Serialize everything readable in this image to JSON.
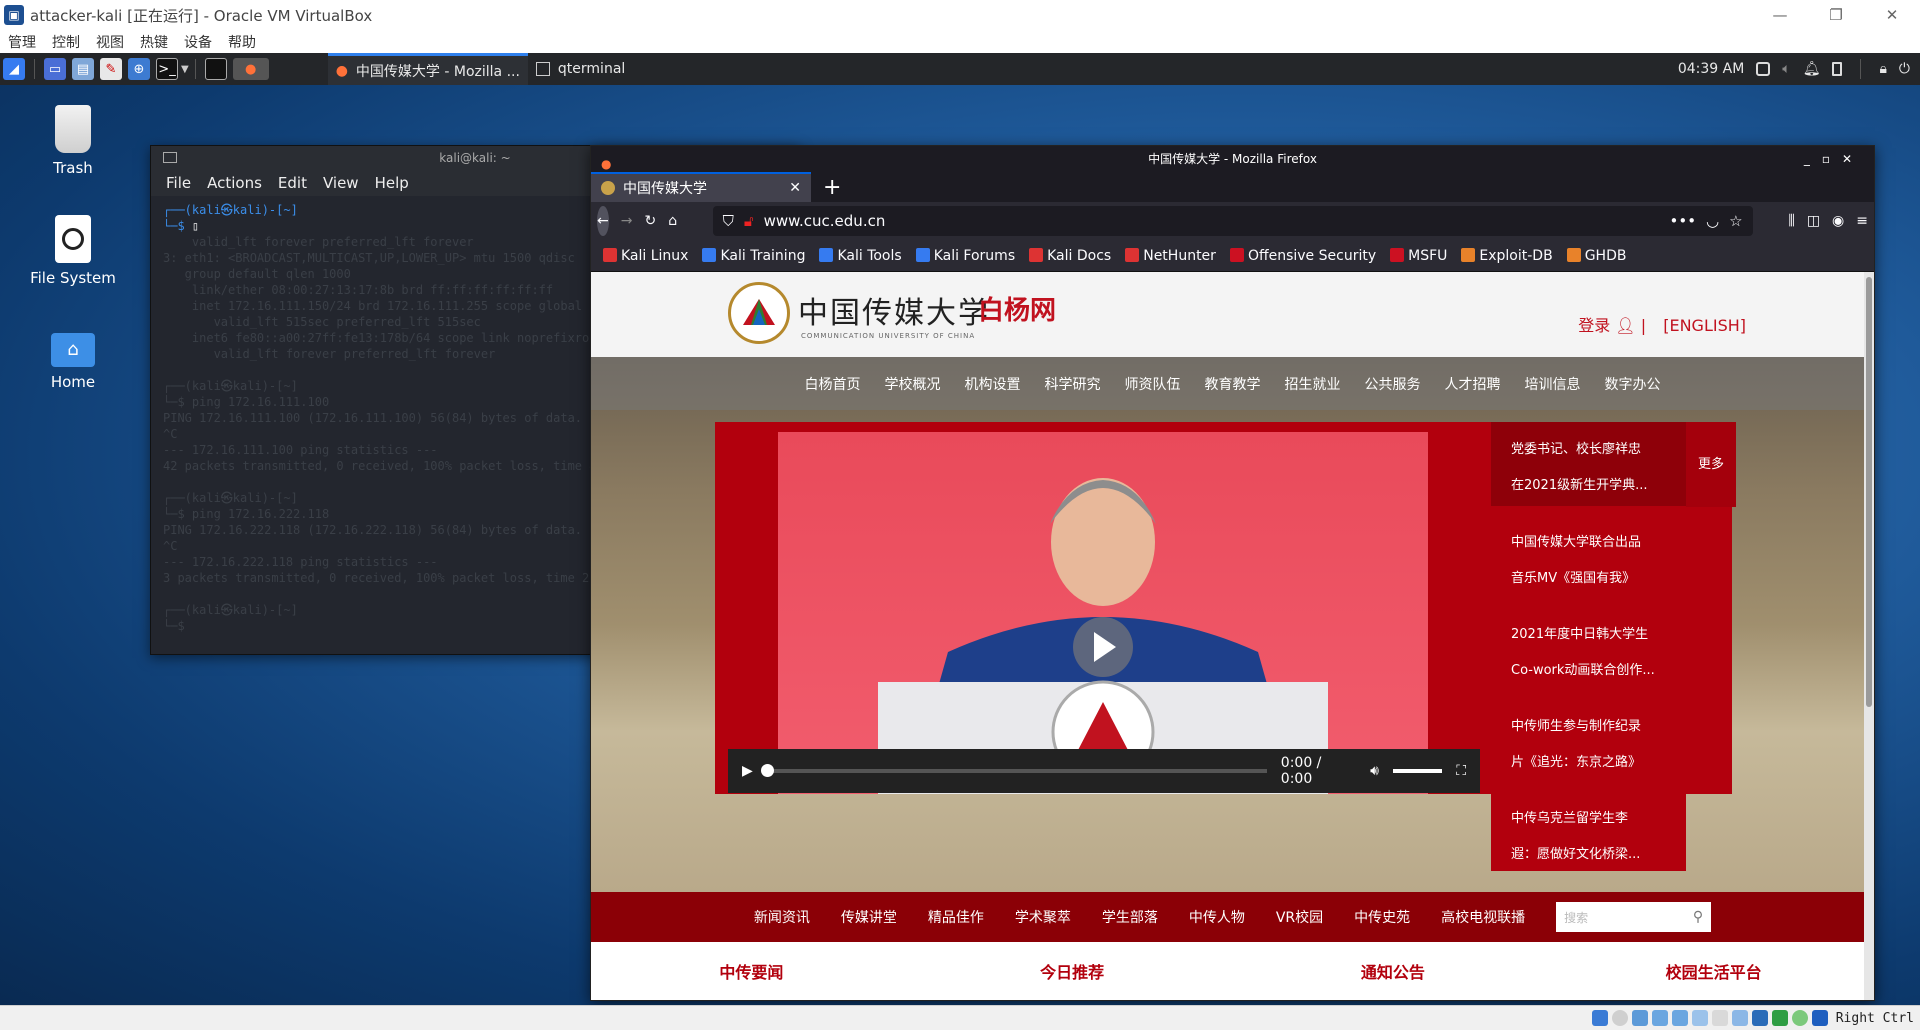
{
  "vbox": {
    "title": "attacker-kali [正在运行] - Oracle VM VirtualBox",
    "menu": [
      "管理",
      "控制",
      "视图",
      "热键",
      "设备",
      "帮助"
    ],
    "host_key": "Right Ctrl"
  },
  "panel": {
    "tasks": [
      {
        "label": "中国传媒大学 - Mozilla ..."
      },
      {
        "label": "qterminal"
      }
    ],
    "time": "04:39 AM"
  },
  "desktop": {
    "icons": [
      {
        "label": "Trash"
      },
      {
        "label": "File System"
      },
      {
        "label": "Home"
      }
    ]
  },
  "terminal": {
    "title": "kali@kali: ~",
    "menu": [
      "File",
      "Actions",
      "Edit",
      "View",
      "Help"
    ],
    "prompt": "┌──(kali㉿kali)-[~]\n└─$ ",
    "history": "    valid_lft forever preferred_lft forever\n3: eth1: <BROADCAST,MULTICAST,UP,LOWER_UP> mtu 1500 qdisc\n   group default qlen 1000\n    link/ether 08:00:27:13:17:8b brd ff:ff:ff:ff:ff:ff\n    inet 172.16.111.150/24 brd 172.16.111.255 scope global dynamic\n       valid_lft 515sec preferred_lft 515sec\n    inet6 fe80::a00:27ff:fe13:178b/64 scope link noprefixroute\n       valid_lft forever preferred_lft forever\n\n┌──(kali㉿kali)-[~]\n└─$ ping 172.16.111.100\nPING 172.16.111.100 (172.16.111.100) 56(84) bytes of data.\n^C\n--- 172.16.111.100 ping statistics ---\n42 packets transmitted, 0 received, 100% packet loss, time 41984ms\n\n┌──(kali㉿kali)-[~]\n└─$ ping 172.16.222.118\nPING 172.16.222.118 (172.16.222.118) 56(84) bytes of data.\n^C\n--- 172.16.222.118 ping statistics ---\n3 packets transmitted, 0 received, 100% packet loss, time 2037ms\n\n┌──(kali㉿kali)-[~]\n└─$ "
  },
  "firefox": {
    "window_title": "中国传媒大学 - Mozilla Firefox",
    "tab": "中国传媒大学",
    "url": "www.cuc.edu.cn",
    "bookmarks": [
      {
        "label": "Kali Linux",
        "color": "#d33"
      },
      {
        "label": "Kali Training",
        "color": "#367bf0"
      },
      {
        "label": "Kali Tools",
        "color": "#367bf0"
      },
      {
        "label": "Kali Forums",
        "color": "#367bf0"
      },
      {
        "label": "Kali Docs",
        "color": "#d33"
      },
      {
        "label": "NetHunter",
        "color": "#d33"
      },
      {
        "label": "Offensive Security",
        "color": "#c12"
      },
      {
        "label": "MSFU",
        "color": "#c12"
      },
      {
        "label": "Exploit-DB",
        "color": "#e8822a"
      },
      {
        "label": "GHDB",
        "color": "#e8822a"
      }
    ]
  },
  "site": {
    "name_cn": "中国传媒大学",
    "baiyang": "白杨网",
    "name_en": "COMMUNICATION UNIVERSITY OF CHINA",
    "login": "登录",
    "english": "[ENGLISH]",
    "topnav": [
      "白杨首页",
      "学校概况",
      "机构设置",
      "科学研究",
      "师资队伍",
      "教育教学",
      "招生就业",
      "公共服务",
      "人才招聘",
      "培训信息",
      "数字办公"
    ],
    "news": [
      {
        "line1": "党委书记、校长廖祥忠",
        "line2": "在2021级新生开学典..."
      },
      {
        "line1": "中国传媒大学联合出品",
        "line2": "音乐MV《强国有我》"
      },
      {
        "line1": "2021年度中日韩大学生",
        "line2": "Co-work动画联合创作..."
      },
      {
        "line1": "中传师生参与制作纪录",
        "line2": "片《追光：东京之路》"
      },
      {
        "line1": "中传乌克兰留学生李",
        "line2": "遐：愿做好文化桥梁..."
      }
    ],
    "more": "更多",
    "video_time": "0:00 / 0:00",
    "video_progress": 0.0,
    "volume": 1.0,
    "subnav": [
      "新闻资讯",
      "传媒讲堂",
      "精品佳作",
      "学术聚萃",
      "学生部落",
      "中传人物",
      "VR校园",
      "中传史苑",
      "高校电视联播"
    ],
    "search_placeholder": "搜索",
    "sections": [
      "中传要闻",
      "今日推荐",
      "通知公告",
      "校园生活平台"
    ]
  }
}
